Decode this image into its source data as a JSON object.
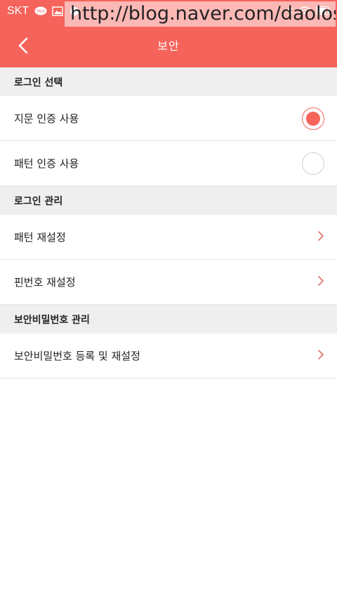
{
  "status_bar": {
    "carrier": "SKT",
    "talk_badge": "TALK"
  },
  "watermark": "http://blog.naver.com/daolos",
  "app_bar": {
    "title": "보안"
  },
  "sections": [
    {
      "header": "로그인 선택",
      "items": [
        {
          "label": "지문 인증 사용",
          "control": "radio",
          "checked": true
        },
        {
          "label": "패턴 인증 사용",
          "control": "radio",
          "checked": false
        }
      ]
    },
    {
      "header": "로그인 관리",
      "items": [
        {
          "label": "패턴 재설정",
          "control": "chevron"
        },
        {
          "label": "핀번호 재설정",
          "control": "chevron"
        }
      ]
    },
    {
      "header": "보안비밀번호 관리",
      "items": [
        {
          "label": "보안비밀번호 등록 및 재설정",
          "control": "chevron"
        }
      ]
    }
  ],
  "colors": {
    "accent": "#f6635b",
    "section_bg": "#efefef",
    "chevron": "#e0726c"
  }
}
